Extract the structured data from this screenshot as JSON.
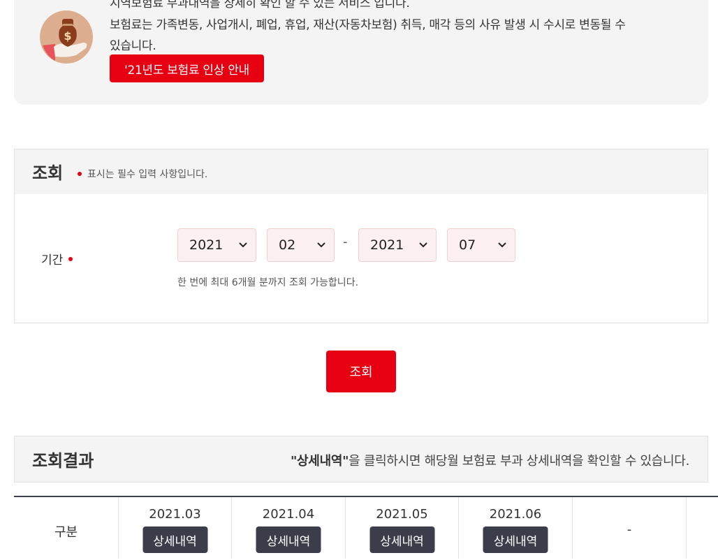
{
  "info": {
    "line1": "지역보험료 부과내역을 상세히 확인 할 수 있는 서비스 입니다.",
    "line2": "보험료는 가족변동, 사업개시, 폐업, 휴업, 재산(자동차보험) 취득, 매각 등의 사유 발생 시 수시로 변동될 수",
    "line3": "있습니다.",
    "notice_button": "'21년도 보험료 인상 안내",
    "icon": "money-bag-icon",
    "icon_symbol": "$"
  },
  "query": {
    "title": "조회",
    "required_note": "표시는 필수 입력 사항입니다.",
    "period_label": "기간",
    "from_year": "2021",
    "from_month": "02",
    "separator": "-",
    "to_year": "2021",
    "to_month": "07",
    "hint": "한 번에 최대 6개월 분까지 조회 가능합니다.",
    "search_button": "조회"
  },
  "result": {
    "title": "조회결과",
    "note_bold": "\"상세내역\"",
    "note_rest": "을 클릭하시면 해당월 보험료 부과 상세내역을 확인할 수 있습니다.",
    "row_header": "구분",
    "columns": [
      {
        "month": "2021.03",
        "button": "상세내역"
      },
      {
        "month": "2021.04",
        "button": "상세내역"
      },
      {
        "month": "2021.05",
        "button": "상세내역"
      },
      {
        "month": "2021.06",
        "button": "상세내역"
      }
    ],
    "empty_cell": "-"
  },
  "colors": {
    "accent": "#e60012",
    "dark_button": "#3c3d4a",
    "panel_bg": "#f4f4f5",
    "select_bg": "#fdf0f0"
  }
}
